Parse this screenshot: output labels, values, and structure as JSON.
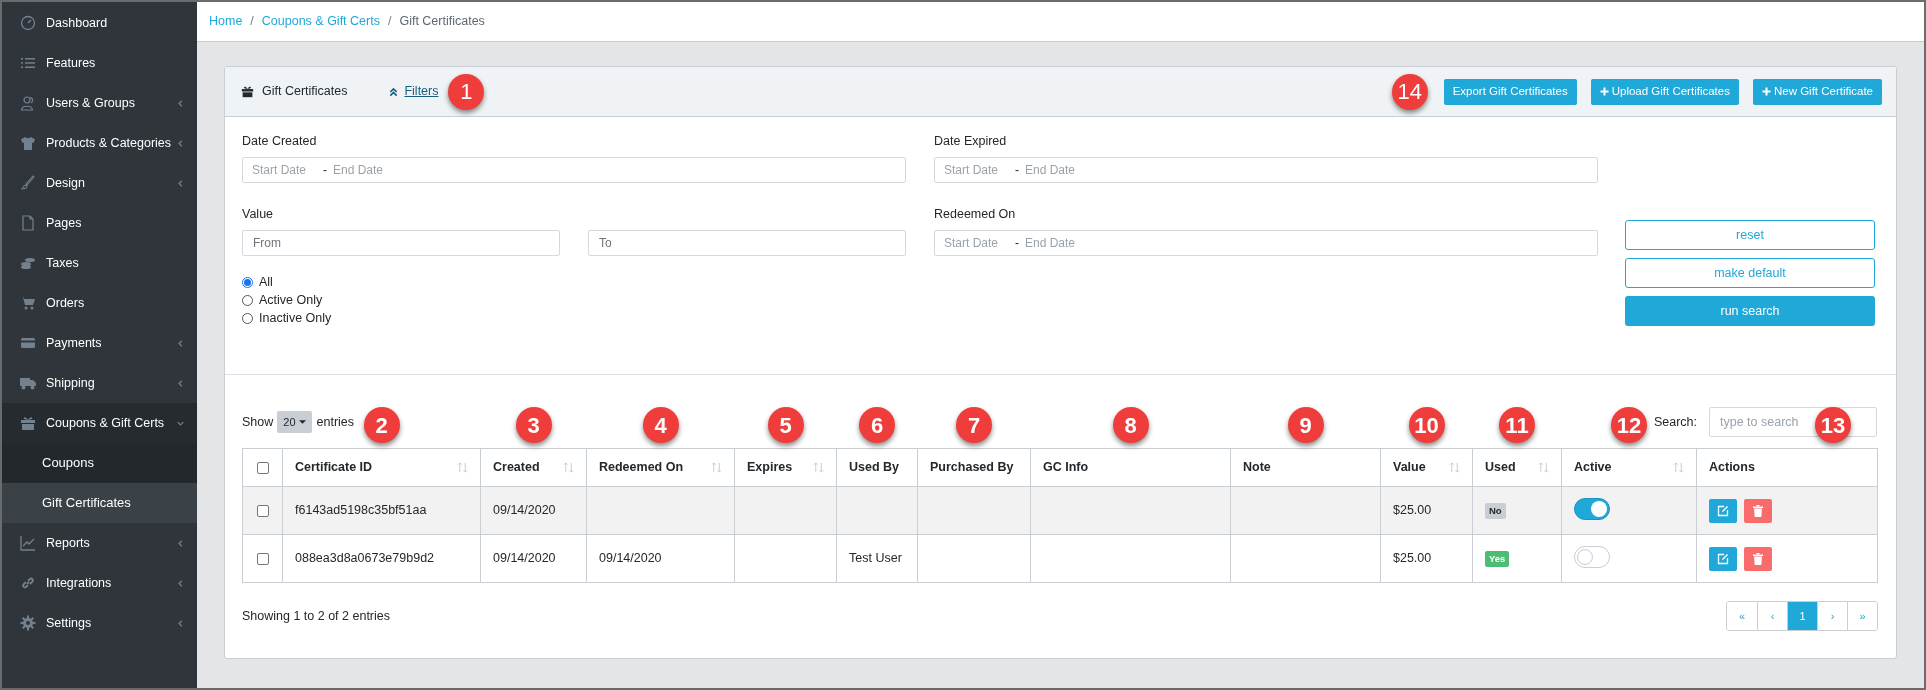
{
  "sidebar": {
    "items": [
      {
        "label": "Dashboard",
        "expandable": false
      },
      {
        "label": "Features",
        "expandable": false
      },
      {
        "label": "Users & Groups",
        "expandable": true,
        "expanded": false
      },
      {
        "label": "Products & Categories",
        "expandable": true,
        "expanded": false
      },
      {
        "label": "Design",
        "expandable": true,
        "expanded": false
      },
      {
        "label": "Pages",
        "expandable": false
      },
      {
        "label": "Taxes",
        "expandable": false
      },
      {
        "label": "Orders",
        "expandable": false
      },
      {
        "label": "Payments",
        "expandable": true,
        "expanded": false
      },
      {
        "label": "Shipping",
        "expandable": true,
        "expanded": false
      },
      {
        "label": "Coupons & Gift Certs",
        "expandable": true,
        "expanded": true,
        "children": [
          {
            "label": "Coupons",
            "selected": false
          },
          {
            "label": "Gift Certificates",
            "selected": true
          }
        ]
      },
      {
        "label": "Reports",
        "expandable": true,
        "expanded": false
      },
      {
        "label": "Integrations",
        "expandable": true,
        "expanded": false
      },
      {
        "label": "Settings",
        "expandable": true,
        "expanded": false
      }
    ]
  },
  "breadcrumb": [
    {
      "label": "Home",
      "kind": "link"
    },
    {
      "label": "/",
      "kind": "separator"
    },
    {
      "label": "Coupons & Gift Certs",
      "kind": "link"
    },
    {
      "label": "/",
      "kind": "separator"
    },
    {
      "label": "Gift Certificates",
      "kind": "current"
    }
  ],
  "card": {
    "title": "Gift Certificates",
    "filters_link": "Filters",
    "callout": "1",
    "buttons_callout": "14",
    "buttons": [
      {
        "label": "Export Gift Certificates",
        "kind": "plain"
      },
      {
        "label": "Upload Gift Certificates",
        "kind": "add"
      },
      {
        "label": "New Gift Certificate",
        "kind": "add"
      }
    ]
  },
  "filters": {
    "date_created": {
      "label": "Date Created",
      "start_placeholder": "Start Date",
      "separator": "-",
      "end_placeholder": "End Date"
    },
    "date_expired": {
      "label": "Date Expired",
      "start_placeholder": "Start Date",
      "separator": "-",
      "end_placeholder": "End Date"
    },
    "value": {
      "label": "Value",
      "from_placeholder": "From",
      "to_placeholder": "To"
    },
    "redeemed_on": {
      "label": "Redeemed On",
      "start_placeholder": "Start Date",
      "separator": "-",
      "end_placeholder": "End Date"
    },
    "status_options": [
      {
        "label": "All",
        "selected": true
      },
      {
        "label": "Active Only",
        "selected": false
      },
      {
        "label": "Inactive Only",
        "selected": false
      }
    ],
    "actions": [
      {
        "label": "reset",
        "kind": "outline"
      },
      {
        "label": "make default",
        "kind": "outline"
      },
      {
        "label": "run search",
        "kind": "primary"
      }
    ]
  },
  "table": {
    "length": {
      "show_label": "Show",
      "value": "20",
      "entries_label": "entries"
    },
    "search": {
      "label": "Search:",
      "placeholder": "type to search"
    },
    "select_all_checked": false,
    "columns": [
      {
        "label": "Certificate ID",
        "sortable": true,
        "callout": "2"
      },
      {
        "label": "Created",
        "sortable": true,
        "callout": "3"
      },
      {
        "label": "Redeemed On",
        "sortable": true,
        "callout": "4"
      },
      {
        "label": "Expires",
        "sortable": true,
        "callout": "5"
      },
      {
        "label": "Used By",
        "sortable": false,
        "callout": "6"
      },
      {
        "label": "Purchased By",
        "sortable": false,
        "callout": "7"
      },
      {
        "label": "GC Info",
        "sortable": false,
        "callout": "8"
      },
      {
        "label": "Note",
        "sortable": false,
        "callout": "9"
      },
      {
        "label": "Value",
        "sortable": true,
        "callout": "10"
      },
      {
        "label": "Used",
        "sortable": true,
        "callout": "11"
      },
      {
        "label": "Active",
        "sortable": true,
        "callout": "12"
      },
      {
        "label": "Actions",
        "sortable": false,
        "callout": "13"
      }
    ],
    "rows": [
      {
        "checked": false,
        "certificate_id": "f6143ad5198c35bf51aa",
        "created": "09/14/2020",
        "value": "$25.00",
        "used": {
          "label": "No",
          "kind": "no"
        },
        "active": true
      },
      {
        "checked": false,
        "certificate_id": "088ea3d8a0673e79b9d2",
        "created": "09/14/2020",
        "redeemed_on": "09/14/2020",
        "used_by": "Test User",
        "value": "$25.00",
        "used": {
          "label": "Yes",
          "kind": "yes"
        },
        "active": false
      }
    ],
    "info": "Showing 1 to 2 of 2 entries",
    "pagination": [
      {
        "label": "«",
        "selected": false
      },
      {
        "label": "‹",
        "selected": false
      },
      {
        "label": "1",
        "selected": true
      },
      {
        "label": "›",
        "selected": false
      },
      {
        "label": "»",
        "selected": false
      }
    ]
  }
}
